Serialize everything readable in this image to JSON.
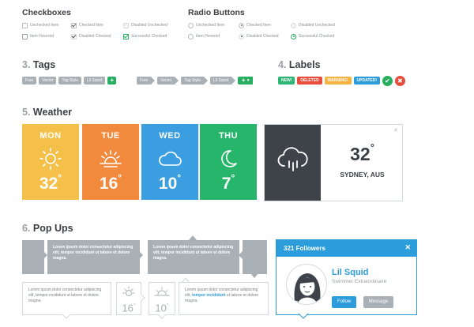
{
  "checkboxes": {
    "title": "Checkboxes",
    "items": [
      {
        "label": "Unchecked Item"
      },
      {
        "label": "Checked Item"
      },
      {
        "label": "Disabled Unchecked"
      },
      {
        "label": "Item Hovered"
      },
      {
        "label": "Disabled Checked"
      },
      {
        "label": "Successful Checked"
      }
    ]
  },
  "radios": {
    "title": "Radio Buttons",
    "items": [
      {
        "label": "Unchecked Item"
      },
      {
        "label": "Checked Item"
      },
      {
        "label": "Disabled Unchecked"
      },
      {
        "label": "Item Hovered"
      },
      {
        "label": "Disabled Checked"
      },
      {
        "label": "Successful Checked"
      }
    ]
  },
  "tags": {
    "num": "3.",
    "title": "Tags",
    "set1": [
      "Free",
      "Vector",
      "Tag Style",
      "Lil Squid"
    ],
    "set2": [
      "Free",
      "Vector",
      "Tag Style",
      "Lil Squid"
    ],
    "add": "+",
    "add_more": "+ •"
  },
  "labels": {
    "num": "4.",
    "title": "Labels",
    "items": [
      {
        "text": "NEW!",
        "color": "#2bb673"
      },
      {
        "text": "DELETED",
        "color": "#e74c3c"
      },
      {
        "text": "WARNING!",
        "color": "#f5b342"
      },
      {
        "text": "UPDATED!",
        "color": "#2d9cdb"
      }
    ],
    "ok": "✔",
    "cancel": "✖"
  },
  "weather": {
    "num": "5.",
    "title": "Weather",
    "days": [
      {
        "day": "MON",
        "temp": "32",
        "icon": "sun-icon",
        "color": "#f5c04a"
      },
      {
        "day": "TUE",
        "temp": "16",
        "icon": "sunset-icon",
        "color": "#f28a3d"
      },
      {
        "day": "WED",
        "temp": "10",
        "icon": "cloud-icon",
        "color": "#3a9ee0"
      },
      {
        "day": "THU",
        "temp": "7",
        "icon": "moon-icon",
        "color": "#27b56b"
      }
    ],
    "deg": "°",
    "current": {
      "temp": "32",
      "city": "SYDNEY, AUS",
      "icon": "rain-cloud-icon"
    },
    "close": "✕"
  },
  "popups": {
    "num": "6.",
    "title": "Pop Ups",
    "lorem": "Lorem ipsum dolor consectetur adipiscing elit, tempor incididunt ut labore et dolore magna.",
    "lorem_a": "Lorem ipsum dolor consectetur adipiscing elit,",
    "lorem_link": "tempor incididunt",
    "lorem_b": "ut labore et dolore magna.",
    "mini_temps": [
      "16",
      "10"
    ],
    "deg": "°"
  },
  "profile": {
    "followers": "321 Followers",
    "close": "✕",
    "name": "Lil Squid",
    "role": "Swimmer Extraordinaire",
    "follow": "Follow",
    "message": "Message",
    "accent": "#2d9cdb"
  }
}
